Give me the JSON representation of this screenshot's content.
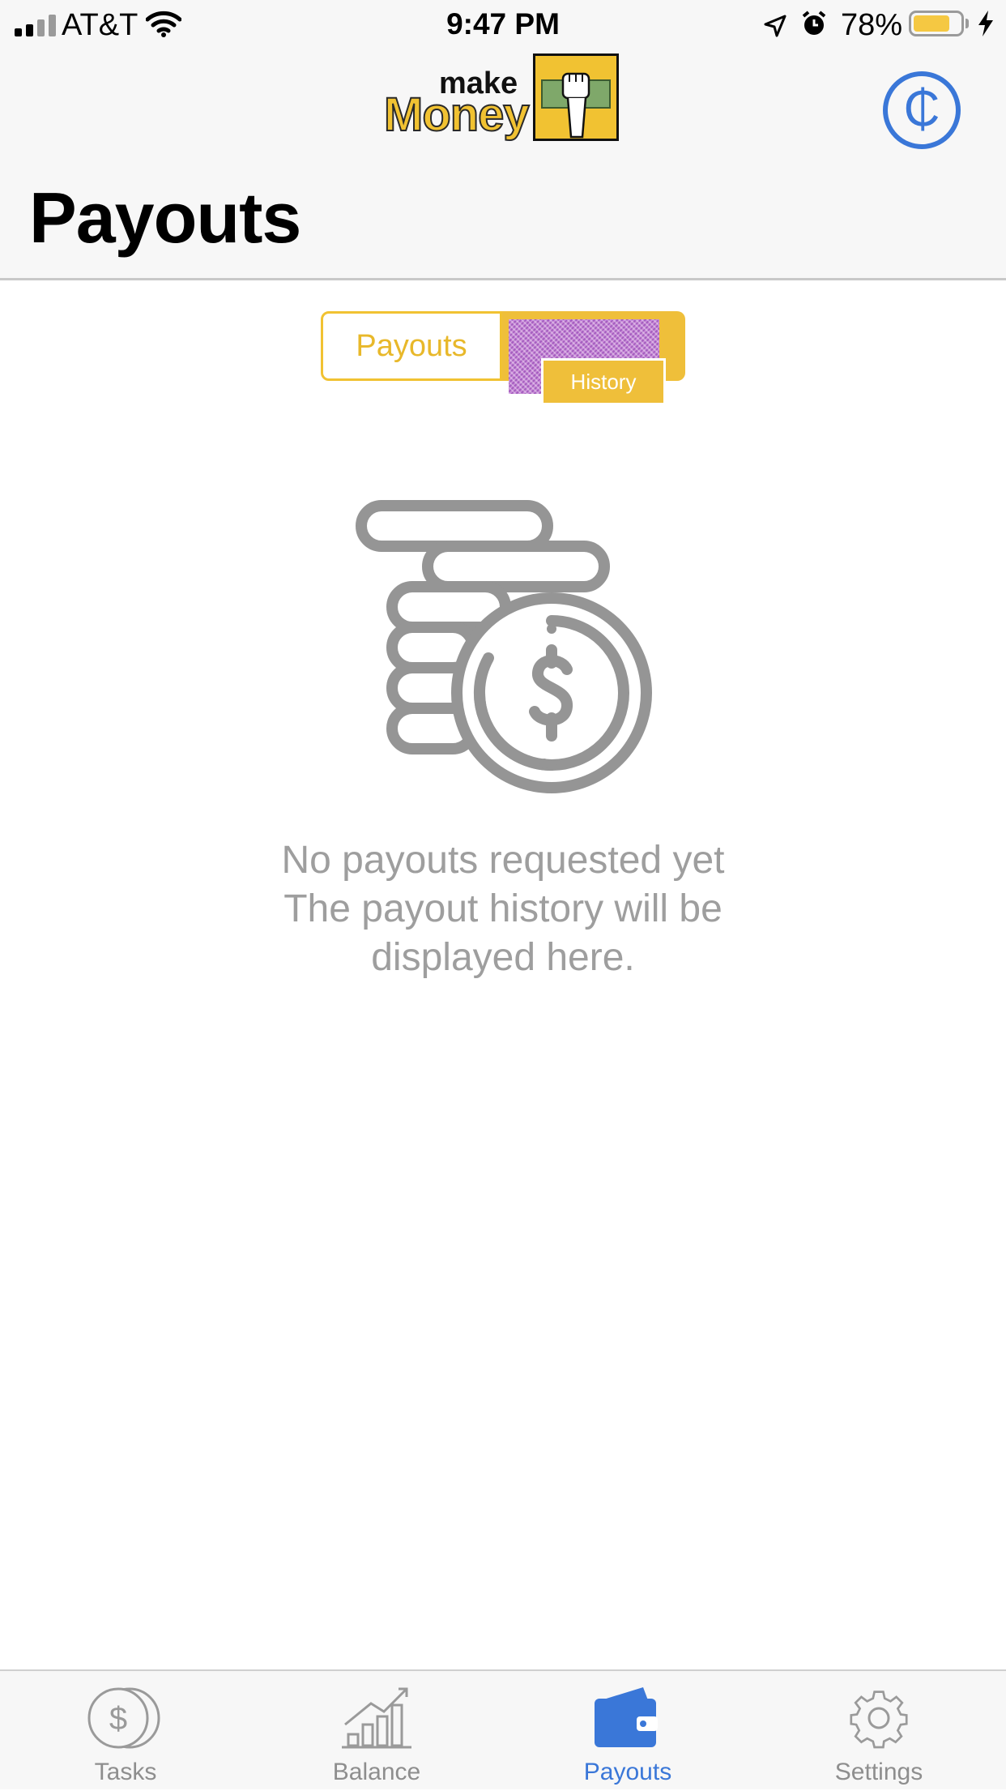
{
  "status_bar": {
    "carrier": "AT&T",
    "time": "9:47 PM",
    "battery_percent": "78%",
    "battery_level": 0.78,
    "icons": [
      "signal-icon",
      "wifi-icon",
      "location-arrow-icon",
      "alarm-icon",
      "battery-icon",
      "charging-bolt-icon"
    ]
  },
  "header": {
    "logo": {
      "line1": "make",
      "line2": "Money"
    },
    "title": "Payouts",
    "action_icon": "cedi-icon",
    "accent_color": "#3a77d8"
  },
  "segmented_control": {
    "payouts_label": "Payouts",
    "history_label": "History",
    "accent_color": "#f1c232"
  },
  "empty_state": {
    "icon": "coins-stack-icon",
    "line1": "No payouts requested yet",
    "line2": "The payout history will be",
    "line3": "displayed here."
  },
  "tab_bar": {
    "tabs": [
      {
        "label": "Tasks",
        "icon": "coins-icon",
        "active": false
      },
      {
        "label": "Balance",
        "icon": "bar-chart-icon",
        "active": false
      },
      {
        "label": "Payouts",
        "icon": "wallet-icon",
        "active": true
      },
      {
        "label": "Settings",
        "icon": "gear-icon",
        "active": false
      }
    ]
  }
}
